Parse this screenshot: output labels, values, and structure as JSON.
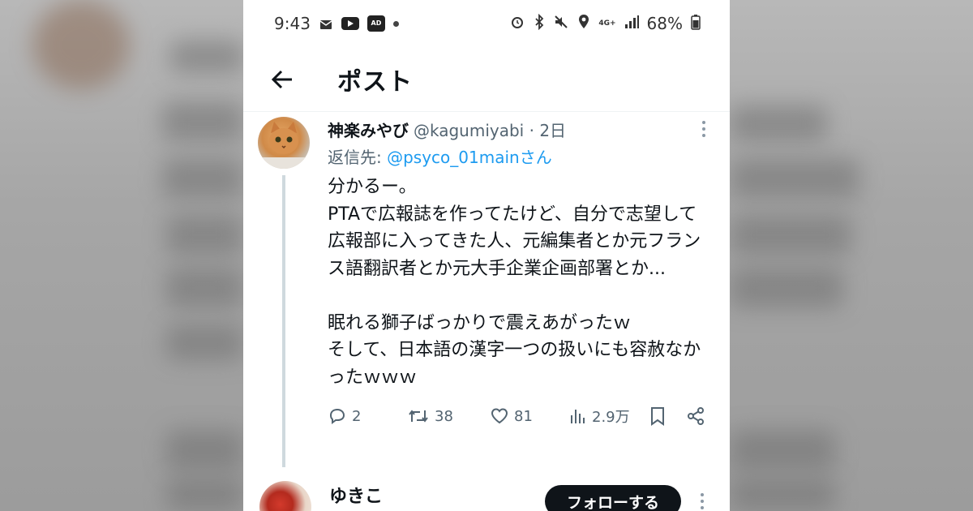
{
  "status_bar": {
    "time": "9:43",
    "battery": "68%",
    "network": "4G+"
  },
  "header": {
    "title": "ポスト"
  },
  "tweet": {
    "author_name": "神楽みやび",
    "handle_time": "@kagumiyabi · 2日",
    "reply_prefix": "返信先: ",
    "reply_to": "@psyco_01mainさん",
    "body": "分かるー。\nPTAで広報誌を作ってたけど、自分で志望して広報部に入ってきた人、元編集者とか元フランス語翻訳者とか元大手企業企画部署とか...\n\n眠れる獅子ばっかりで震えあがったｗ\nそして、日本語の漢字一つの扱いにも容赦なかったｗｗｗ",
    "replies": "2",
    "retweets": "38",
    "likes": "81",
    "views": "2.9万"
  },
  "next_tweet": {
    "author_name": "ゆきこ",
    "follow_label": "フォローする"
  },
  "icons": {
    "back": "arrow-left-icon",
    "reply": "reply-icon",
    "retweet": "retweet-icon",
    "like": "heart-icon",
    "views": "views-icon",
    "bookmark": "bookmark-icon",
    "share": "share-icon"
  }
}
